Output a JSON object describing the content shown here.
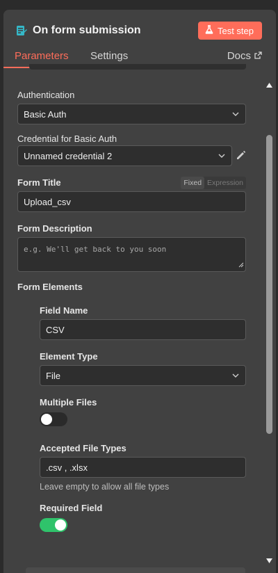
{
  "header": {
    "title": "On form submission",
    "test_button": "Test step",
    "icon": "form-node-icon"
  },
  "tabs": {
    "parameters": "Parameters",
    "settings": "Settings",
    "docs": "Docs"
  },
  "form": {
    "authentication": {
      "label": "Authentication",
      "value": "Basic Auth"
    },
    "credential": {
      "label": "Credential for Basic Auth",
      "value": "Unnamed credential 2"
    },
    "form_title": {
      "label": "Form Title",
      "value": "Upload_csv",
      "mode_fixed": "Fixed",
      "mode_expression": "Expression"
    },
    "form_description": {
      "label": "Form Description",
      "placeholder": "e.g. We'll get back to you soon"
    },
    "form_elements": {
      "label": "Form Elements",
      "field_name": {
        "label": "Field Name",
        "value": "CSV"
      },
      "element_type": {
        "label": "Element Type",
        "value": "File"
      },
      "multiple_files": {
        "label": "Multiple Files",
        "enabled": false
      },
      "accepted_file_types": {
        "label": "Accepted File Types",
        "value": ".csv , .xlsx",
        "hint": "Leave empty to allow all file types"
      },
      "required_field": {
        "label": "Required Field",
        "enabled": true
      }
    }
  },
  "colors": {
    "accent": "#ff6d5a",
    "toggle_on": "#2fc36b",
    "panel_bg": "#414141",
    "input_bg": "#2e2e2e"
  }
}
